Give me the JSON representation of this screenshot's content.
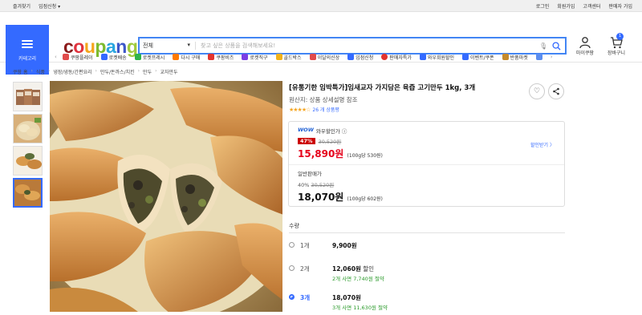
{
  "topbar": {
    "left": [
      "즐겨찾기",
      "입점신청 ▾"
    ],
    "right": [
      "로그인",
      "회원가입",
      "고객센터",
      "판매자 가입"
    ]
  },
  "header": {
    "category_label": "카테고리",
    "logo": [
      "c",
      "o",
      "u",
      "p",
      "a",
      "n",
      "g"
    ],
    "search_category": "전체",
    "search_placeholder": "찾고 싶은 상품을 검색해보세요!",
    "mypage_label": "마이쿠팡",
    "cart_label": "장바구니",
    "cart_count": "1"
  },
  "quick_links": [
    {
      "label": "쿠팡플레이",
      "color": "#e14b4b"
    },
    {
      "label": "로켓배송",
      "color": "#346aff"
    },
    {
      "label": "로켓프레시",
      "color": "#2fb34a"
    },
    {
      "label": "다시 구매",
      "color": "#ff7a00"
    },
    {
      "label": "쿠팡비즈",
      "color": "#e3342f"
    },
    {
      "label": "로켓직구",
      "color": "#7b3fe4"
    },
    {
      "label": "골드박스",
      "color": "#f1b21a"
    },
    {
      "label": "이달의신상",
      "color": "#e14b4b"
    },
    {
      "label": "입점신청",
      "color": "#346aff"
    },
    {
      "label": "판매자특가",
      "color": "#e3342f"
    },
    {
      "label": "와우회원할인",
      "color": "#346aff"
    },
    {
      "label": "이벤트/쿠폰",
      "color": "#346aff"
    },
    {
      "label": "반품마켓",
      "color": "#c58a2b"
    },
    {
      "label": "",
      "color": "#5b8def"
    }
  ],
  "breadcrumb": [
    "쿠팡 홈",
    "식품",
    "냉장/냉동/간편요리",
    "만두/돈까스/치킨",
    "만두",
    "교자만두"
  ],
  "product": {
    "title": "[유통기한 임박특가]임새교자 가지담은 육즙 고기만두 1kg, 3개",
    "origin": "원산지: 상품 상세설명 참조",
    "stars": "★★★★☆",
    "rating": 4.5,
    "review_count": "26 개 상품평"
  },
  "price": {
    "wow_label": "와우할인가 ⓘ",
    "wow_brand": "WOW",
    "discount_pct": "47%",
    "original": "30,520원",
    "wow_price": "15,890원",
    "wow_unit": "(100g당 530원)",
    "coupon": "할인받기 〉",
    "general_label": "일반판매가",
    "general_pct": "40%",
    "general_original": "30,520원",
    "general_price": "18,070원",
    "general_unit": "(100g당 602원)"
  },
  "quantity": {
    "label": "수량",
    "options": [
      {
        "name": "1개",
        "price": "9,900원",
        "note": "",
        "save": "",
        "selected": false
      },
      {
        "name": "2개",
        "price": "12,060원",
        "note": " 할인",
        "save": "2개 사면 7,740원 절약",
        "selected": false
      },
      {
        "name": "3개",
        "price": "18,070원",
        "note": "",
        "save": "3개 사면 11,630원 절약",
        "selected": true
      }
    ]
  },
  "colors": {
    "accent": "#346aff",
    "price_red": "#e5001a",
    "save_green": "#2a9a2a"
  }
}
